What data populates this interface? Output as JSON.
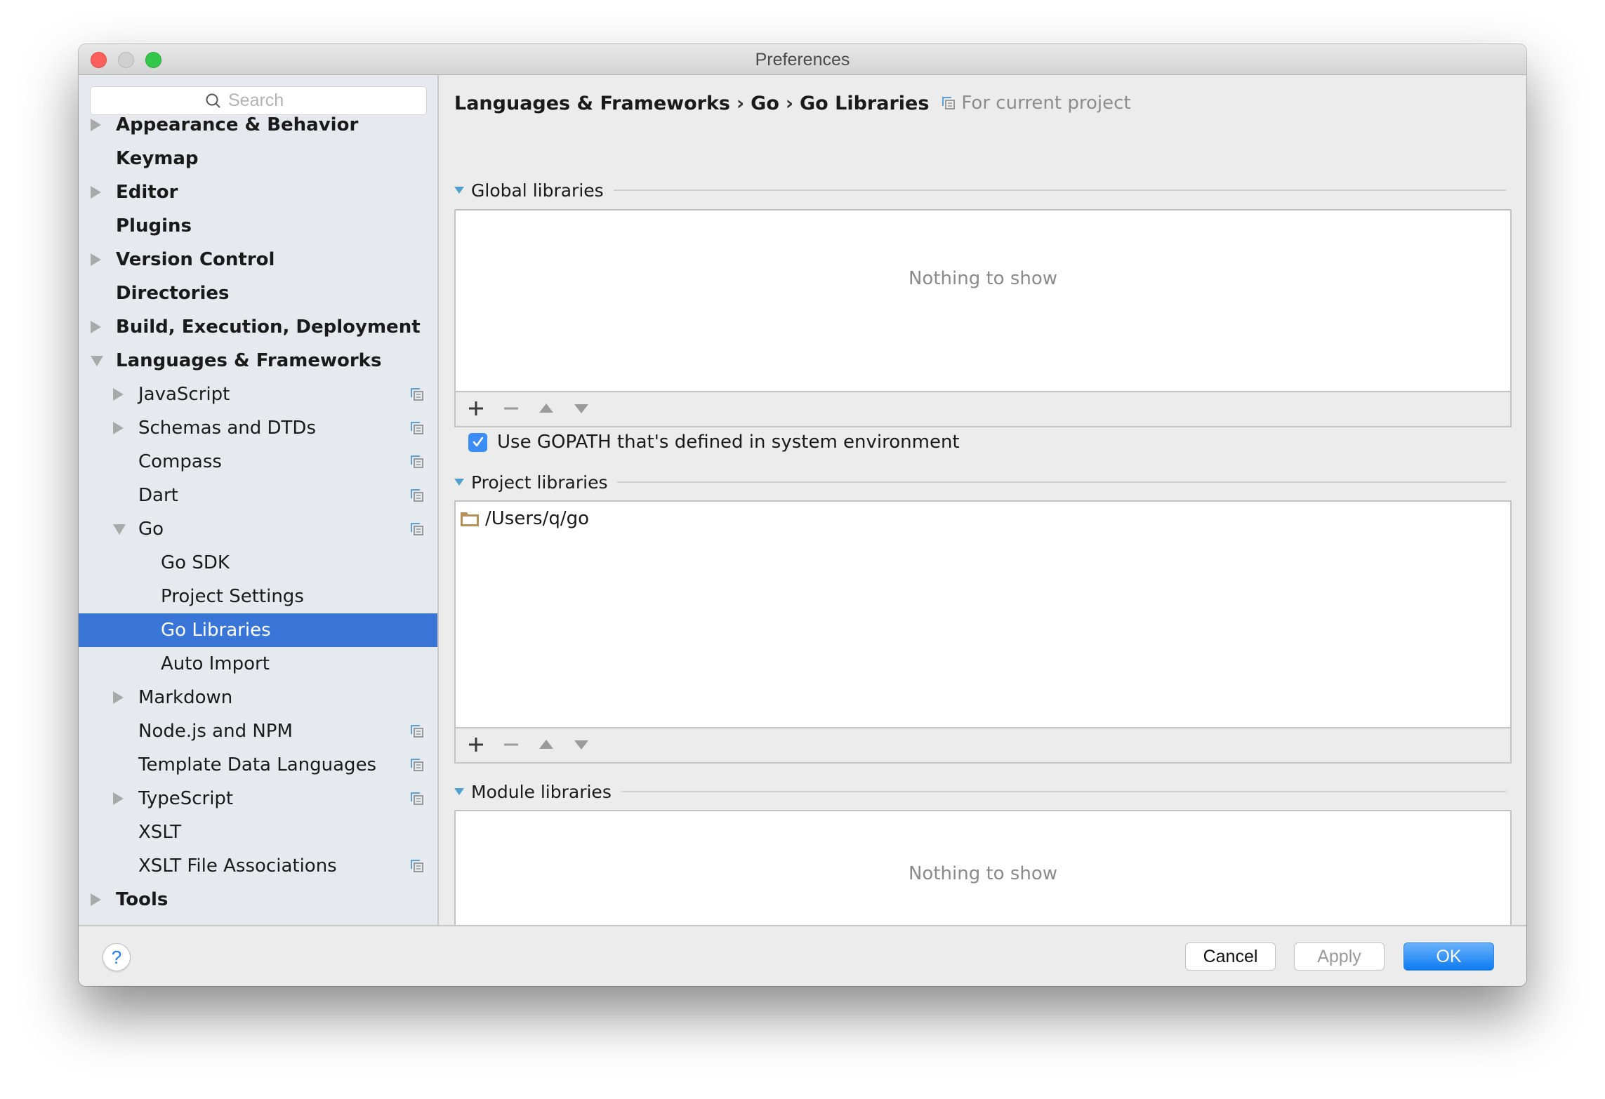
{
  "window": {
    "title": "Preferences"
  },
  "sidebar": {
    "search_placeholder": "Search",
    "items": [
      {
        "label": "Appearance & Behavior",
        "level": 0,
        "bold": true,
        "arrow": "right",
        "project_icon": false
      },
      {
        "label": "Keymap",
        "level": 0,
        "bold": true,
        "arrow": "none",
        "project_icon": false
      },
      {
        "label": "Editor",
        "level": 0,
        "bold": true,
        "arrow": "right",
        "project_icon": false
      },
      {
        "label": "Plugins",
        "level": 0,
        "bold": true,
        "arrow": "none",
        "project_icon": false
      },
      {
        "label": "Version Control",
        "level": 0,
        "bold": true,
        "arrow": "right",
        "project_icon": false
      },
      {
        "label": "Directories",
        "level": 0,
        "bold": true,
        "arrow": "none",
        "project_icon": false
      },
      {
        "label": "Build, Execution, Deployment",
        "level": 0,
        "bold": true,
        "arrow": "right",
        "project_icon": false
      },
      {
        "label": "Languages & Frameworks",
        "level": 0,
        "bold": true,
        "arrow": "down",
        "project_icon": false
      },
      {
        "label": "JavaScript",
        "level": 1,
        "bold": false,
        "arrow": "right",
        "project_icon": true
      },
      {
        "label": "Schemas and DTDs",
        "level": 1,
        "bold": false,
        "arrow": "right",
        "project_icon": true
      },
      {
        "label": "Compass",
        "level": 1,
        "bold": false,
        "arrow": "none",
        "project_icon": true
      },
      {
        "label": "Dart",
        "level": 1,
        "bold": false,
        "arrow": "none",
        "project_icon": true
      },
      {
        "label": "Go",
        "level": 1,
        "bold": false,
        "arrow": "down",
        "project_icon": true
      },
      {
        "label": "Go SDK",
        "level": 2,
        "bold": false,
        "arrow": "none",
        "project_icon": false
      },
      {
        "label": "Project Settings",
        "level": 2,
        "bold": false,
        "arrow": "none",
        "project_icon": false
      },
      {
        "label": "Go Libraries",
        "level": 2,
        "bold": false,
        "arrow": "none",
        "project_icon": false,
        "selected": true
      },
      {
        "label": "Auto Import",
        "level": 2,
        "bold": false,
        "arrow": "none",
        "project_icon": false
      },
      {
        "label": "Markdown",
        "level": 1,
        "bold": false,
        "arrow": "right",
        "project_icon": false
      },
      {
        "label": "Node.js and NPM",
        "level": 1,
        "bold": false,
        "arrow": "none",
        "project_icon": true
      },
      {
        "label": "Template Data Languages",
        "level": 1,
        "bold": false,
        "arrow": "none",
        "project_icon": true
      },
      {
        "label": "TypeScript",
        "level": 1,
        "bold": false,
        "arrow": "right",
        "project_icon": true
      },
      {
        "label": "XSLT",
        "level": 1,
        "bold": false,
        "arrow": "none",
        "project_icon": false
      },
      {
        "label": "XSLT File Associations",
        "level": 1,
        "bold": false,
        "arrow": "none",
        "project_icon": true
      },
      {
        "label": "Tools",
        "level": 0,
        "bold": true,
        "arrow": "right",
        "project_icon": false
      }
    ]
  },
  "main": {
    "breadcrumb": [
      "Languages & Frameworks",
      "Go",
      "Go Libraries"
    ],
    "breadcrumb_separator": "›",
    "scope_label": "For current project",
    "global_libraries": {
      "header": "Global libraries",
      "empty_text": "Nothing to show",
      "items": []
    },
    "use_gopath": {
      "label": "Use GOPATH that's defined in system environment",
      "checked": true
    },
    "project_libraries": {
      "header": "Project libraries",
      "items": [
        "/Users/q/go"
      ]
    },
    "module_libraries": {
      "header": "Module libraries",
      "empty_text": "Nothing to show",
      "items": []
    },
    "toolbar_icons": [
      "plus-icon",
      "minus-icon",
      "move-up-icon",
      "move-down-icon"
    ]
  },
  "footer": {
    "help_label": "?",
    "cancel_label": "Cancel",
    "apply_label": "Apply",
    "ok_label": "OK"
  },
  "colors": {
    "selection": "#3875d7",
    "accent_button": "#0d7cf2",
    "checkbox": "#3b8cf4",
    "section_triangle": "#4f9fd0",
    "folder": "#b89158"
  }
}
